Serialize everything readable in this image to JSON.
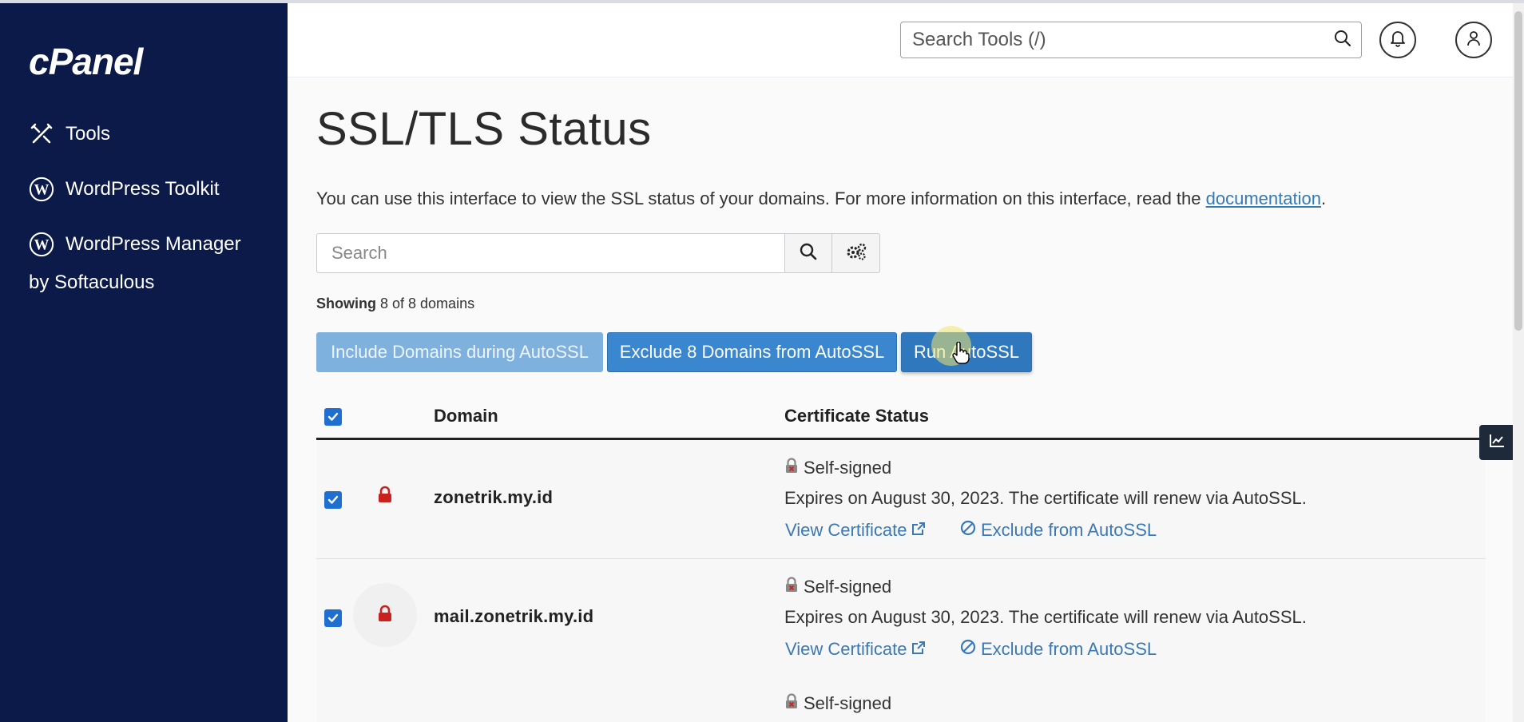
{
  "sidebar": {
    "logo": "cPanel",
    "items": [
      {
        "label": "Tools",
        "icon": "tools-icon"
      },
      {
        "label": "WordPress Toolkit",
        "icon": "wordpress-icon"
      },
      {
        "label": "WordPress Manager",
        "label2": "by Softaculous",
        "icon": "wordpress-icon"
      }
    ]
  },
  "header": {
    "search_placeholder": "Search Tools (/)",
    "icons": [
      "search-icon",
      "bell-icon",
      "user-icon"
    ]
  },
  "main": {
    "title": "SSL/TLS Status",
    "intro_text": "You can use this interface to view the SSL status of your domains. For more information on this interface, read the ",
    "intro_link": "documentation",
    "intro_end": ".",
    "search_placeholder": "Search",
    "showing_bold": "Showing",
    "showing_rest": " 8 of 8 domains",
    "buttons": {
      "include": "Include Domains during AutoSSL",
      "exclude": "Exclude 8 Domains from AutoSSL",
      "run": "Run AutoSSL"
    },
    "table": {
      "columns": [
        "Domain",
        "Certificate Status"
      ],
      "rows": [
        {
          "domain": "zonetrik.my.id",
          "status": "Self-signed",
          "expires": "Expires on August 30, 2023. The certificate will renew via AutoSSL.",
          "view_link": "View Certificate",
          "exclude_link": "Exclude from AutoSSL",
          "checked": true
        },
        {
          "domain": "mail.zonetrik.my.id",
          "status": "Self-signed",
          "expires": "Expires on August 30, 2023. The certificate will renew via AutoSSL.",
          "view_link": "View Certificate",
          "exclude_link": "Exclude from AutoSSL",
          "checked": true
        },
        {
          "status": "Self-signed"
        }
      ]
    }
  },
  "colors": {
    "sidebar_bg": "#0b1a48",
    "primary_button": "#3a87cf",
    "link": "#3a79b6",
    "lock_red": "#c9211e"
  }
}
